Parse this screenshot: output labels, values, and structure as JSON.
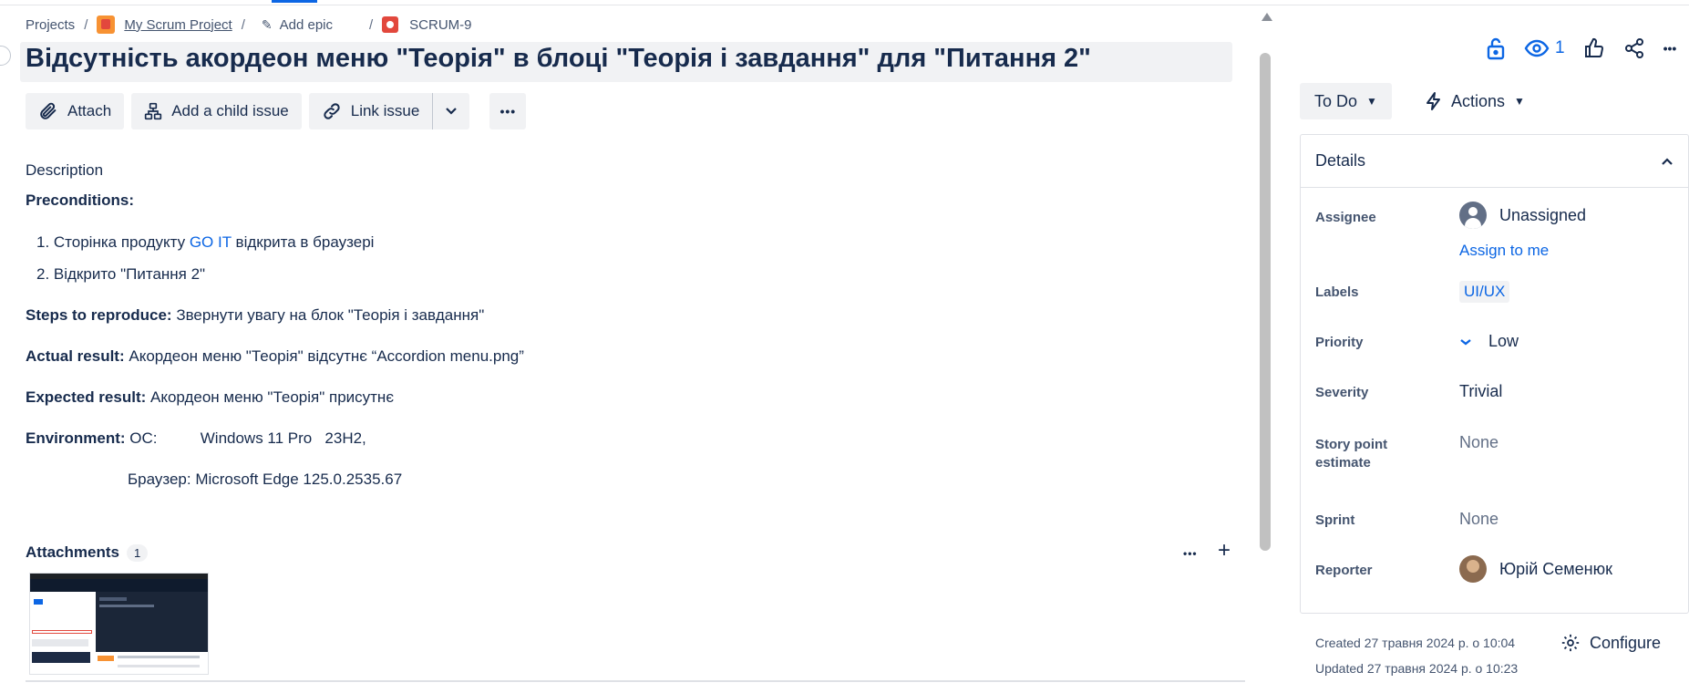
{
  "breadcrumb": {
    "projects": "Projects",
    "project": "My Scrum Project",
    "add_epic": "Add epic",
    "issue_key": "SCRUM-9",
    "sep": "/"
  },
  "issue": {
    "title": "Відсутність акордеон меню \"Теорія\" в блоці \"Теорія і завдання\" для \"Питання 2\""
  },
  "toolbar": {
    "attach": "Attach",
    "add_child": "Add a child issue",
    "link_issue": "Link issue",
    "more": "•••"
  },
  "description": {
    "label": "Description",
    "preconditions_label": "Preconditions:",
    "pre1_prefix": "1. Сторінка продукту ",
    "pre1_link": "GO IT",
    "pre1_suffix": " відкрита в браузері",
    "pre2": "2. Відкрито \"Питання 2\"",
    "steps_label": "Steps to reproduce:",
    "steps_text": " Звернути увагу на блок \"Теорія і завдання\"",
    "actual_label": "Actual result:",
    "actual_text": " Акордеон меню \"Теорія\" відсутнє “Accordion menu.png”",
    "expected_label": "Expected result:",
    "expected_text": " Акордеон меню \"Теорія\" присутнє",
    "env_label": "Environment:",
    "env_os": " ОС:          Windows 11 Pro   23H2,",
    "env_browser": "Браузер: Microsoft Edge 125.0.2535.67"
  },
  "attachments": {
    "title": "Attachments",
    "count": "1"
  },
  "header_actions": {
    "watch_count": "1"
  },
  "status": {
    "current": "To Do",
    "actions": "Actions"
  },
  "details": {
    "title": "Details",
    "assignee_label": "Assignee",
    "assignee_value": "Unassigned",
    "assign_to_me": "Assign to me",
    "labels_label": "Labels",
    "labels_value": "UI/UX",
    "priority_label": "Priority",
    "priority_value": "Low",
    "severity_label": "Severity",
    "severity_value": "Trivial",
    "story_points_label_1": "Story point",
    "story_points_label_2": "estimate",
    "story_points_value": "None",
    "sprint_label": "Sprint",
    "sprint_value": "None",
    "reporter_label": "Reporter",
    "reporter_value": "Юрій Семенюк"
  },
  "meta": {
    "created": "Created 27 травня 2024 р. о 10:04",
    "updated": "Updated 27 травня 2024 р. о 10:23",
    "configure": "Configure"
  },
  "colors": {
    "accent": "#0c66e4",
    "text": "#172b4d",
    "subtle_bg": "#f1f2f4"
  }
}
